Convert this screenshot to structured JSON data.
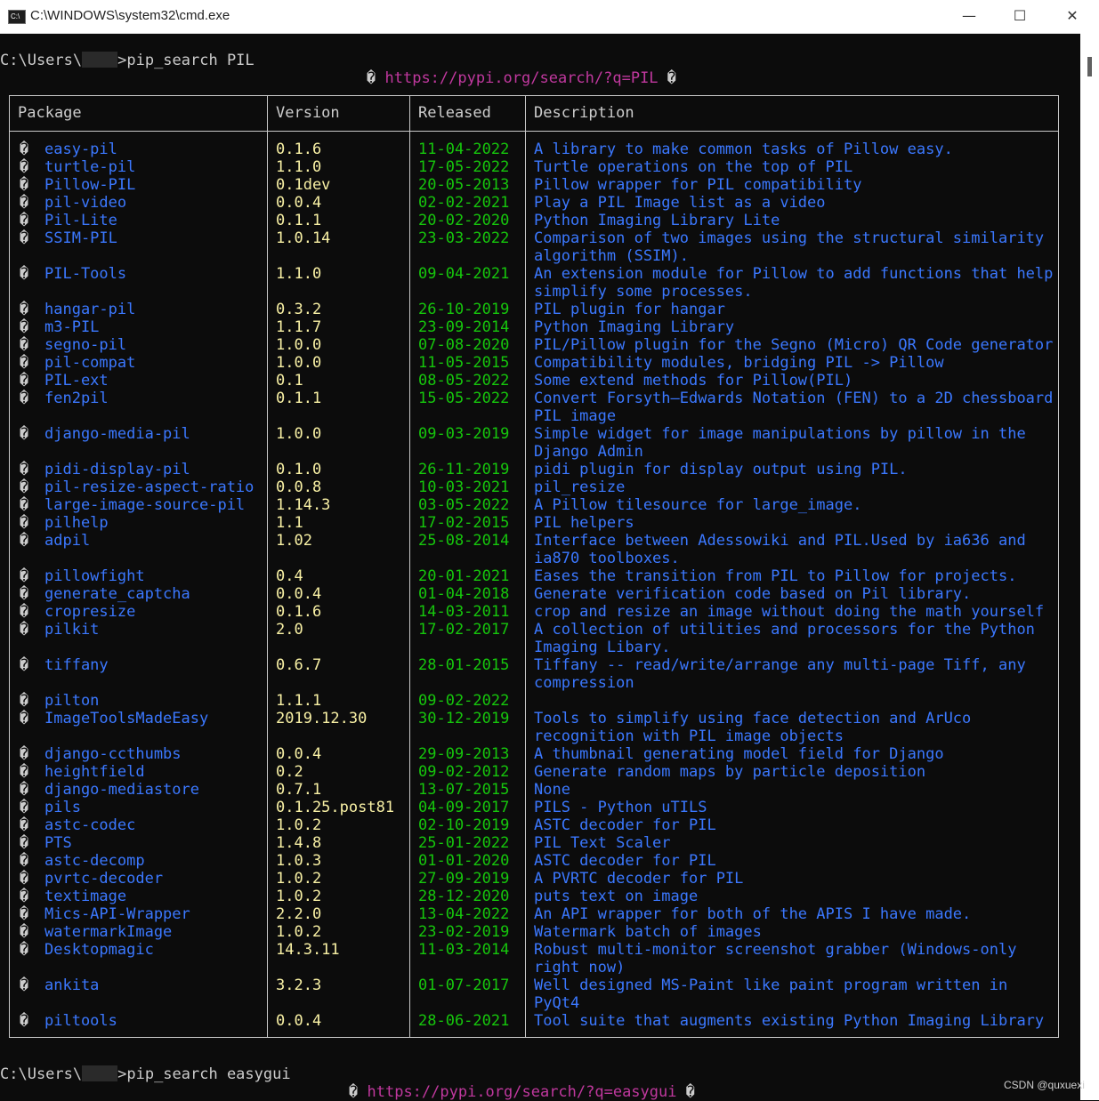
{
  "window": {
    "title": "C:\\WINDOWS\\system32\\cmd.exe",
    "minimize": "—",
    "maximize": "☐",
    "close": "✕"
  },
  "session": {
    "prompt1_prefix": "C:\\Users\\",
    "prompt1_command": ">pip_search PIL",
    "url1": "https://pypi.org/search/?q=PIL",
    "prompt2_prefix": "C:\\Users\\",
    "prompt2_command": ">pip_search easygui",
    "url2": "https://pypi.org/search/?q=easygui",
    "url_glyph": "�"
  },
  "table": {
    "headers": [
      "Package",
      "Version",
      "Released",
      "Description"
    ],
    "rows": [
      {
        "package": "easy-pil",
        "version": "0.1.6",
        "released": "11-04-2022",
        "description": [
          "A library to make common tasks of Pillow easy."
        ]
      },
      {
        "package": "turtle-pil",
        "version": "1.1.0",
        "released": "17-05-2022",
        "description": [
          "Turtle operations on the top of PIL"
        ]
      },
      {
        "package": "Pillow-PIL",
        "version": "0.1dev",
        "released": "20-05-2013",
        "description": [
          "Pillow wrapper for PIL compatibility"
        ]
      },
      {
        "package": "pil-video",
        "version": "0.0.4",
        "released": "02-02-2021",
        "description": [
          "Play a PIL Image list as a video"
        ]
      },
      {
        "package": "Pil-Lite",
        "version": "0.1.1",
        "released": "20-02-2020",
        "description": [
          "Python Imaging Library Lite"
        ]
      },
      {
        "package": "SSIM-PIL",
        "version": "1.0.14",
        "released": "23-03-2022",
        "description": [
          "Comparison of two images using the structural similarity",
          "algorithm (SSIM)."
        ]
      },
      {
        "package": "PIL-Tools",
        "version": "1.1.0",
        "released": "09-04-2021",
        "description": [
          "An extension module for Pillow to add functions that help",
          "simplify some processes."
        ]
      },
      {
        "package": "hangar-pil",
        "version": "0.3.2",
        "released": "26-10-2019",
        "description": [
          "PIL plugin for hangar"
        ]
      },
      {
        "package": "m3-PIL",
        "version": "1.1.7",
        "released": "23-09-2014",
        "description": [
          "Python Imaging Library"
        ]
      },
      {
        "package": "segno-pil",
        "version": "1.0.0",
        "released": "07-08-2020",
        "description": [
          "PIL/Pillow plugin for the Segno (Micro) QR Code generator"
        ]
      },
      {
        "package": "pil-compat",
        "version": "1.0.0",
        "released": "11-05-2015",
        "description": [
          "Compatibility modules, bridging PIL -> Pillow"
        ]
      },
      {
        "package": "PIL-ext",
        "version": "0.1",
        "released": "08-05-2022",
        "description": [
          "Some extend methods for Pillow(PIL)"
        ]
      },
      {
        "package": "fen2pil",
        "version": "0.1.1",
        "released": "15-05-2022",
        "description": [
          "Convert Forsyth–Edwards Notation (FEN) to a 2D chessboard",
          "PIL image"
        ]
      },
      {
        "package": "django-media-pil",
        "version": "1.0.0",
        "released": "09-03-2019",
        "description": [
          "Simple widget for image manipulations by pillow in the",
          "Django Admin"
        ]
      },
      {
        "package": "pidi-display-pil",
        "version": "0.1.0",
        "released": "26-11-2019",
        "description": [
          "pidi plugin for display output using PIL."
        ]
      },
      {
        "package": "pil-resize-aspect-ratio",
        "version": "0.0.8",
        "released": "10-03-2021",
        "description": [
          "pil_resize"
        ]
      },
      {
        "package": "large-image-source-pil",
        "version": "1.14.3",
        "released": "03-05-2022",
        "description": [
          "A Pillow tilesource for large_image."
        ]
      },
      {
        "package": "pilhelp",
        "version": "1.1",
        "released": "17-02-2015",
        "description": [
          "PIL helpers"
        ]
      },
      {
        "package": "adpil",
        "version": "1.02",
        "released": "25-08-2014",
        "description": [
          "Interface between Adessowiki and PIL.Used by ia636 and",
          "ia870 toolboxes."
        ]
      },
      {
        "package": "pillowfight",
        "version": "0.4",
        "released": "20-01-2021",
        "description": [
          "Eases the transition from PIL to Pillow for projects."
        ]
      },
      {
        "package": "generate_captcha",
        "version": "0.0.4",
        "released": "01-04-2018",
        "description": [
          "Generate verification code based on Pil library."
        ]
      },
      {
        "package": "cropresize",
        "version": "0.1.6",
        "released": "14-03-2011",
        "description": [
          "crop and resize an image without doing the math yourself"
        ]
      },
      {
        "package": "pilkit",
        "version": "2.0",
        "released": "17-02-2017",
        "description": [
          "A collection of utilities and processors for the Python",
          "Imaging Libary."
        ]
      },
      {
        "package": "tiffany",
        "version": "0.6.7",
        "released": "28-01-2015",
        "description": [
          "Tiffany -- read/write/arrange any multi-page Tiff, any",
          "compression"
        ]
      },
      {
        "package": "pilton",
        "version": "1.1.1",
        "released": "09-02-2022",
        "description": [
          ""
        ]
      },
      {
        "package": "ImageToolsMadeEasy",
        "version": "2019.12.30",
        "released": "30-12-2019",
        "description": [
          "Tools to simplify using face detection and ArUco",
          "recognition with PIL image objects"
        ]
      },
      {
        "package": "django-ccthumbs",
        "version": "0.0.4",
        "released": "29-09-2013",
        "description": [
          "A thumbnail generating model field for Django"
        ]
      },
      {
        "package": "heightfield",
        "version": "0.2",
        "released": "09-02-2012",
        "description": [
          "Generate random maps by particle deposition"
        ]
      },
      {
        "package": "django-mediastore",
        "version": "0.7.1",
        "released": "13-07-2015",
        "description": [
          "None"
        ]
      },
      {
        "package": "pils",
        "version": "0.1.25.post81",
        "released": "04-09-2017",
        "description": [
          "PILS - Python uTILS"
        ]
      },
      {
        "package": "astc-codec",
        "version": "1.0.2",
        "released": "02-10-2019",
        "description": [
          "ASTC decoder for PIL"
        ]
      },
      {
        "package": "PTS",
        "version": "1.4.8",
        "released": "25-01-2022",
        "description": [
          "PIL Text Scaler"
        ]
      },
      {
        "package": "astc-decomp",
        "version": "1.0.3",
        "released": "01-01-2020",
        "description": [
          "ASTC decoder for PIL"
        ]
      },
      {
        "package": "pvrtc-decoder",
        "version": "1.0.2",
        "released": "27-09-2019",
        "description": [
          "A PVRTC decoder for PIL"
        ]
      },
      {
        "package": "textimage",
        "version": "1.0.2",
        "released": "28-12-2020",
        "description": [
          "puts text on image"
        ]
      },
      {
        "package": "Mics-API-Wrapper",
        "version": "2.2.0",
        "released": "13-04-2022",
        "description": [
          "An API wrapper for both of the APIS I have made."
        ]
      },
      {
        "package": "watermarkImage",
        "version": "1.0.2",
        "released": "23-02-2019",
        "description": [
          "Watermark batch of images"
        ]
      },
      {
        "package": "Desktopmagic",
        "version": "14.3.11",
        "released": "11-03-2014",
        "description": [
          "Robust multi-monitor screenshot grabber (Windows-only",
          "right now)"
        ]
      },
      {
        "package": "ankita",
        "version": "3.2.3",
        "released": "01-07-2017",
        "description": [
          "Well designed MS-Paint like paint program written in",
          "PyQt4"
        ]
      },
      {
        "package": "piltools",
        "version": "0.0.4",
        "released": "28-06-2021",
        "description": [
          "Tool suite that augments existing Python Imaging Library"
        ]
      }
    ]
  },
  "watermark": "CSDN @quxuexi"
}
